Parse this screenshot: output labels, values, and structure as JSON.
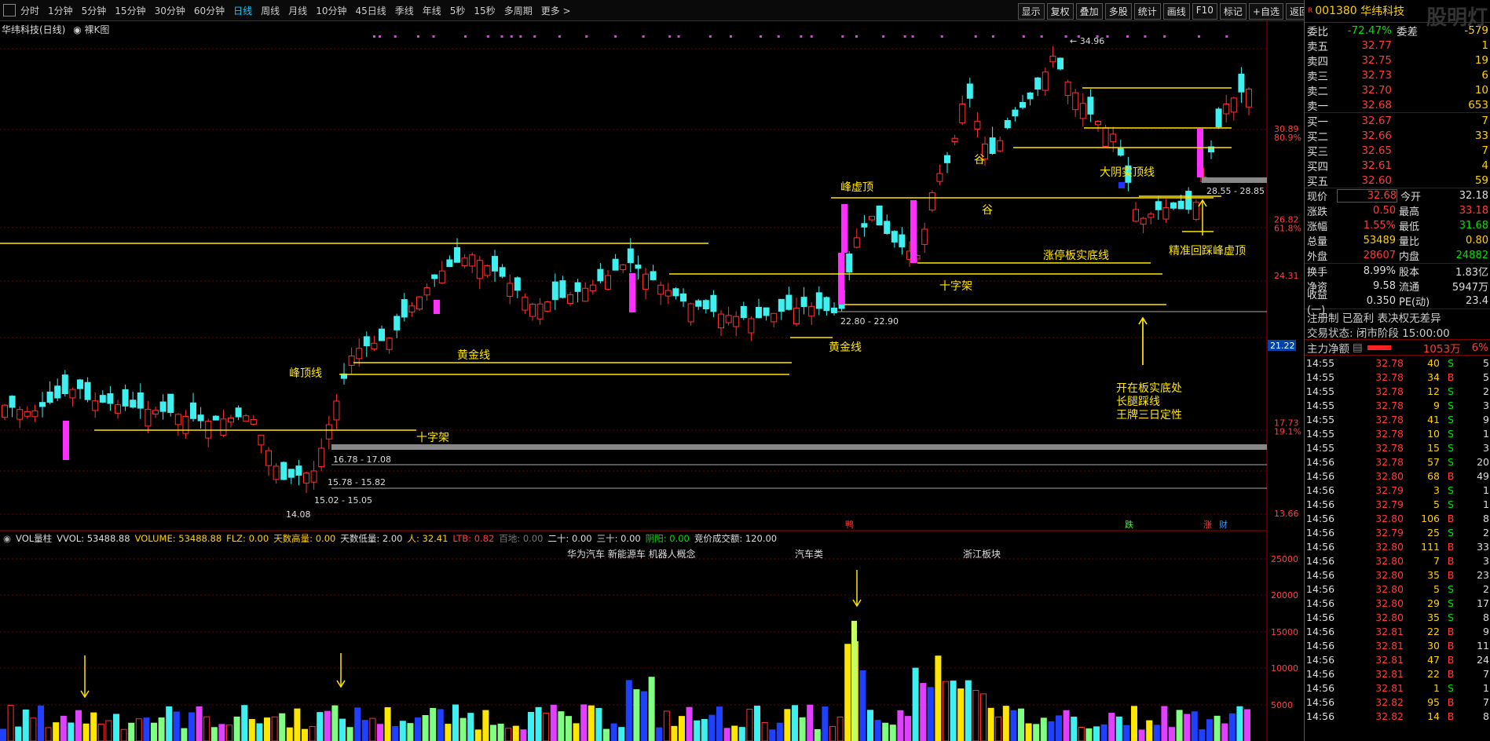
{
  "periods": [
    "分时",
    "1分钟",
    "5分钟",
    "15分钟",
    "30分钟",
    "60分钟",
    "日线",
    "周线",
    "月线",
    "10分钟",
    "45日线",
    "季线",
    "年线",
    "5秒",
    "15秒",
    "多周期",
    "更多 >"
  ],
  "active_period": "日线",
  "tools": [
    "显示",
    "复权",
    "叠加",
    "多股",
    "统计",
    "画线",
    "F10",
    "标记",
    "+自选",
    "返回"
  ],
  "chart": {
    "title": "华纬科技(日线)",
    "tag": "裸K图",
    "price_labels": [
      {
        "text": "30.89",
        "pct": "80.9%",
        "v": 30.89
      },
      {
        "text": "26.82",
        "pct": "61.8%",
        "v": 26.82
      },
      {
        "text": "24.31",
        "pct": "",
        "v": 24.31
      },
      {
        "text": "21.22",
        "pct": "",
        "v": 21.22
      },
      {
        "text": "17.73",
        "pct": "19.1%",
        "v": 17.73
      },
      {
        "text": "13.66",
        "pct": "",
        "v": 13.66
      }
    ],
    "current_price_tag": "21.22",
    "high_label": "34.96",
    "low_label": "14.08",
    "annotations": [
      "峰虚顶",
      "谷",
      "谷",
      "大阴实顶线",
      "涨停板实底线",
      "精准回踩峰虚顶",
      "十字架",
      "十字架",
      "黄金线",
      "黄金线",
      "峰顶线",
      "开在板实底处",
      "长腿踩线",
      "王牌三日定性"
    ],
    "range_labels": [
      "28.55 - 28.85",
      "22.80 - 22.90",
      "16.78 - 17.08",
      "15.78 - 15.82",
      "15.02 - 15.05"
    ],
    "bottom_markers": [
      "鸭",
      "跌",
      "涨",
      "财"
    ]
  },
  "volume": {
    "header": [
      {
        "t": "VOL量柱",
        "c": "#dddddd"
      },
      {
        "t": "VVOL: 53488.88",
        "c": "#dddddd"
      },
      {
        "t": "VOLUME: 53488.88",
        "c": "#ffd000"
      },
      {
        "t": "FLZ: 0.00",
        "c": "#ffd000"
      },
      {
        "t": "天数高量: 0.00",
        "c": "#ffd000"
      },
      {
        "t": "天数低量: 2.00",
        "c": "#dddddd"
      },
      {
        "t": "人: 32.41",
        "c": "#ffd000"
      },
      {
        "t": "LTB: 0.82",
        "c": "#ff3b3b"
      },
      {
        "t": "百地: 0.00",
        "c": "#777777"
      },
      {
        "t": "二十: 0.00",
        "c": "#dddddd"
      },
      {
        "t": "三十: 0.00",
        "c": "#dddddd"
      },
      {
        "t": "阴阳: 0.00",
        "c": "#00e000"
      },
      {
        "t": "竞价成交额: 120.00",
        "c": "#dddddd"
      }
    ],
    "concepts": [
      "华为汽车 新能源车 机器人概念",
      "汽车类",
      "浙江板块"
    ],
    "axis": [
      "25000",
      "20000",
      "15000",
      "10000",
      "5000"
    ]
  },
  "quote": {
    "code": "001380",
    "name": "华纬科技",
    "watermark": "股明灯",
    "weibi_label": "委比",
    "weibi": "-72.47%",
    "weicha_label": "委差",
    "weicha": "-579",
    "sells": [
      {
        "label": "卖五",
        "price": "32.77",
        "vol": "1"
      },
      {
        "label": "卖四",
        "price": "32.75",
        "vol": "19"
      },
      {
        "label": "卖三",
        "price": "32.73",
        "vol": "6"
      },
      {
        "label": "卖二",
        "price": "32.70",
        "vol": "10"
      },
      {
        "label": "卖一",
        "price": "32.68",
        "vol": "653"
      }
    ],
    "buys": [
      {
        "label": "买一",
        "price": "32.67",
        "vol": "7"
      },
      {
        "label": "买二",
        "price": "32.66",
        "vol": "33"
      },
      {
        "label": "买三",
        "price": "32.65",
        "vol": "7"
      },
      {
        "label": "买四",
        "price": "32.61",
        "vol": "4"
      },
      {
        "label": "买五",
        "price": "32.60",
        "vol": "59"
      }
    ],
    "stats": [
      {
        "a": "现价",
        "b": "32.68",
        "bc": "red",
        "c": "今开",
        "d": "32.18",
        "dc": "white"
      },
      {
        "a": "涨跌",
        "b": "0.50",
        "bc": "red",
        "c": "最高",
        "d": "33.18",
        "dc": "red"
      },
      {
        "a": "涨幅",
        "b": "1.55%",
        "bc": "red",
        "c": "最低",
        "d": "31.68",
        "dc": "green"
      },
      {
        "a": "总量",
        "b": "53489",
        "bc": "yellow",
        "c": "量比",
        "d": "0.80",
        "dc": "yellow"
      },
      {
        "a": "外盘",
        "b": "28607",
        "bc": "red",
        "c": "内盘",
        "d": "24882",
        "dc": "green"
      }
    ],
    "stats2": [
      {
        "a": "换手",
        "b": "8.99%",
        "bc": "white",
        "c": "股本",
        "d": "1.83亿",
        "dc": "white"
      },
      {
        "a": "净资",
        "b": "9.58",
        "bc": "white",
        "c": "流通",
        "d": "5947万",
        "dc": "white"
      },
      {
        "a": "收益(一)",
        "b": "0.350",
        "bc": "white",
        "c": "PE(动)",
        "d": "23.4",
        "dc": "white"
      }
    ],
    "reg": "注册制 已盈利 表决权无差异",
    "trade_state": "交易状态: 闭市阶段 15:00:00",
    "main_flow_label": "主力净额",
    "main_flow": "1053万",
    "main_flow_pct": "6%",
    "ticks": [
      {
        "t": "14:55",
        "p": "32.78",
        "v": "40",
        "s": "S",
        "n": "5"
      },
      {
        "t": "14:55",
        "p": "32.78",
        "v": "34",
        "s": "B",
        "n": "5"
      },
      {
        "t": "14:55",
        "p": "32.78",
        "v": "12",
        "s": "S",
        "n": "2"
      },
      {
        "t": "14:55",
        "p": "32.78",
        "v": "9",
        "s": "S",
        "n": "3"
      },
      {
        "t": "14:55",
        "p": "32.78",
        "v": "41",
        "s": "S",
        "n": "9"
      },
      {
        "t": "14:55",
        "p": "32.78",
        "v": "10",
        "s": "S",
        "n": "1"
      },
      {
        "t": "14:55",
        "p": "32.78",
        "v": "15",
        "s": "S",
        "n": "3"
      },
      {
        "t": "14:56",
        "p": "32.78",
        "v": "57",
        "s": "S",
        "n": "20"
      },
      {
        "t": "14:56",
        "p": "32.80",
        "v": "68",
        "s": "B",
        "n": "49"
      },
      {
        "t": "14:56",
        "p": "32.79",
        "v": "3",
        "s": "S",
        "n": "1"
      },
      {
        "t": "14:56",
        "p": "32.79",
        "v": "5",
        "s": "S",
        "n": "1"
      },
      {
        "t": "14:56",
        "p": "32.80",
        "v": "106",
        "s": "B",
        "n": "8"
      },
      {
        "t": "14:56",
        "p": "32.79",
        "v": "25",
        "s": "S",
        "n": "2"
      },
      {
        "t": "14:56",
        "p": "32.80",
        "v": "111",
        "s": "B",
        "n": "33"
      },
      {
        "t": "14:56",
        "p": "32.80",
        "v": "7",
        "s": "B",
        "n": "3"
      },
      {
        "t": "14:56",
        "p": "32.80",
        "v": "35",
        "s": "B",
        "n": "23"
      },
      {
        "t": "14:56",
        "p": "32.80",
        "v": "5",
        "s": "S",
        "n": "2"
      },
      {
        "t": "14:56",
        "p": "32.80",
        "v": "29",
        "s": "S",
        "n": "17"
      },
      {
        "t": "14:56",
        "p": "32.80",
        "v": "35",
        "s": "S",
        "n": "8"
      },
      {
        "t": "14:56",
        "p": "32.81",
        "v": "22",
        "s": "B",
        "n": "9"
      },
      {
        "t": "14:56",
        "p": "32.81",
        "v": "30",
        "s": "B",
        "n": "11"
      },
      {
        "t": "14:56",
        "p": "32.81",
        "v": "47",
        "s": "B",
        "n": "24"
      },
      {
        "t": "14:56",
        "p": "32.81",
        "v": "22",
        "s": "B",
        "n": "7"
      },
      {
        "t": "14:56",
        "p": "32.81",
        "v": "1",
        "s": "S",
        "n": "1"
      },
      {
        "t": "14:56",
        "p": "32.82",
        "v": "95",
        "s": "B",
        "n": "7"
      },
      {
        "t": "14:56",
        "p": "32.82",
        "v": "14",
        "s": "B",
        "n": "8"
      }
    ]
  }
}
